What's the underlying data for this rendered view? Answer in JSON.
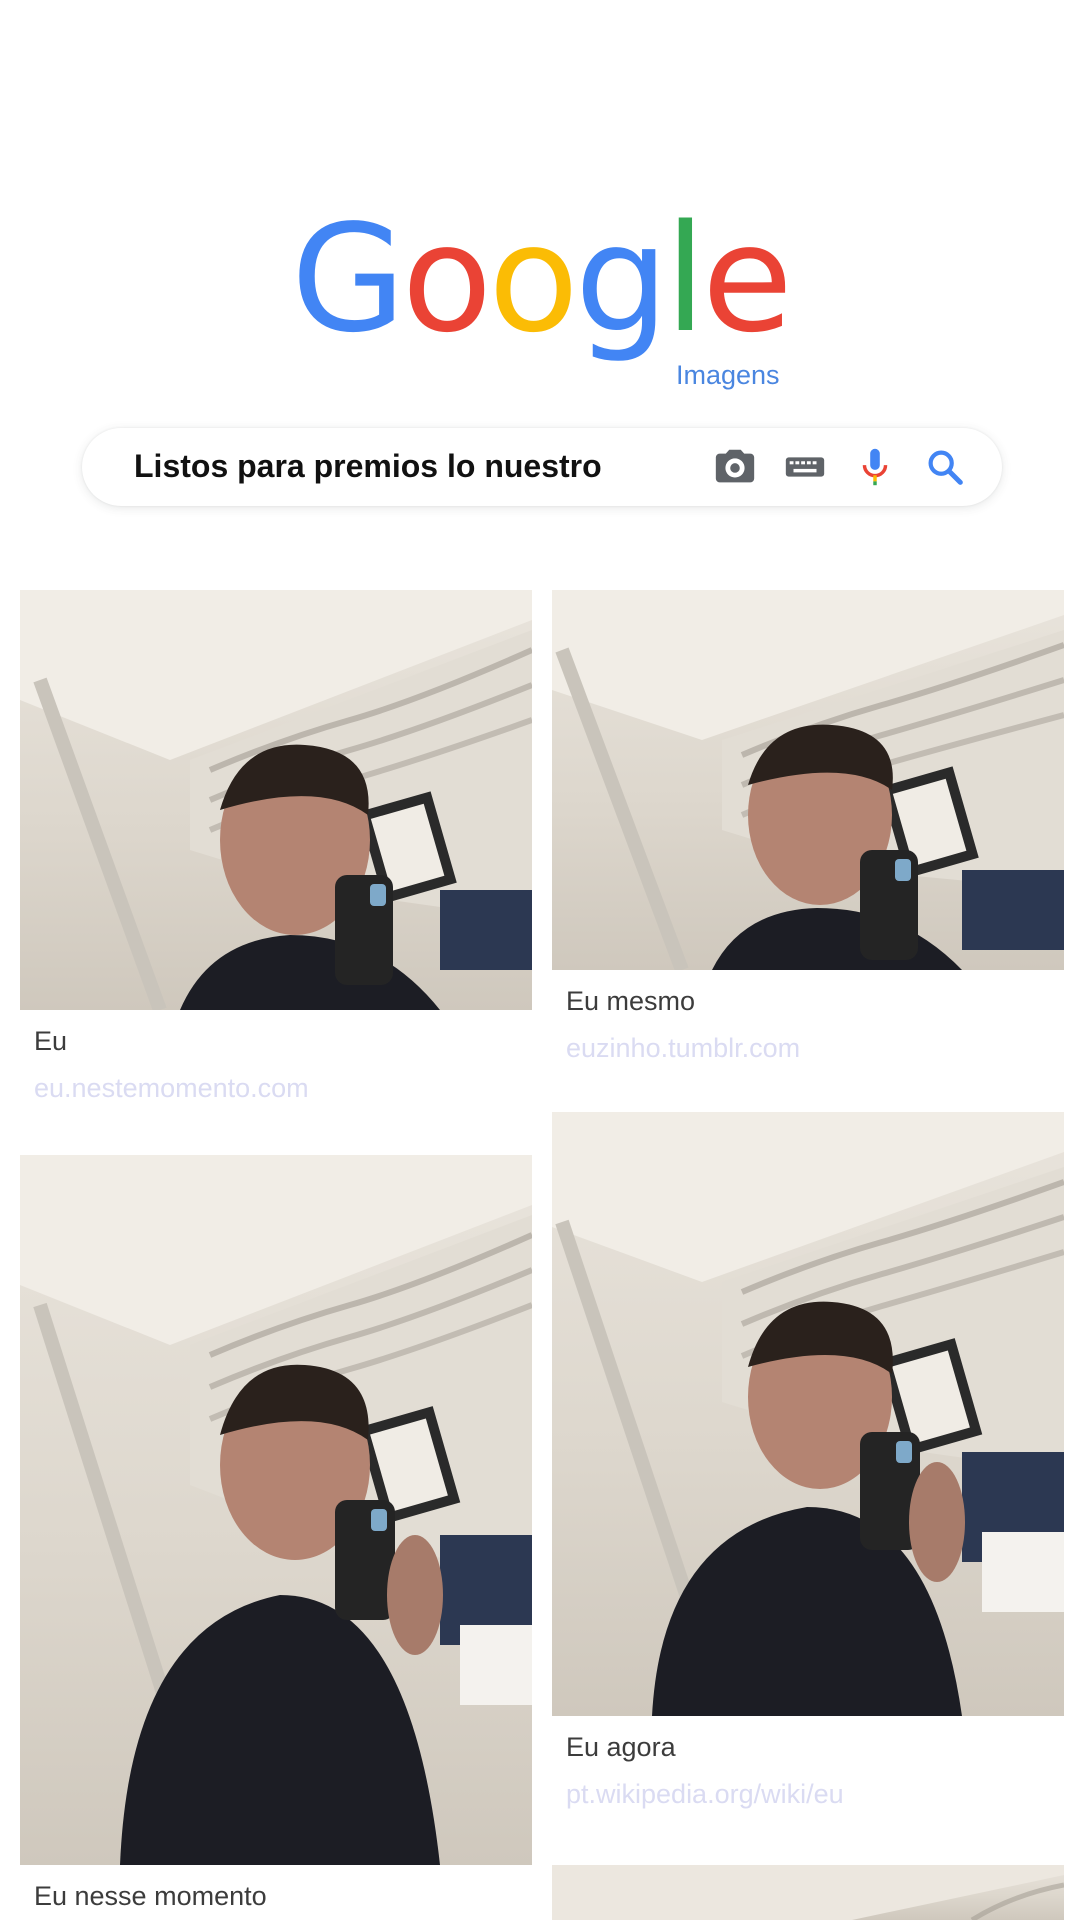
{
  "logo": {
    "letters": [
      {
        "char": "G",
        "color": "#4285F4"
      },
      {
        "char": "o",
        "color": "#EA4335"
      },
      {
        "char": "o",
        "color": "#FBBC05"
      },
      {
        "char": "g",
        "color": "#4285F4"
      },
      {
        "char": "l",
        "color": "#34A853"
      },
      {
        "char": "e",
        "color": "#EA4335"
      }
    ],
    "subtitle": "Imagens"
  },
  "search": {
    "query": "Listos para premios lo nuestro",
    "icons": [
      "camera-icon",
      "keyboard-icon",
      "microphone-icon",
      "search-icon"
    ]
  },
  "results": [
    {
      "title": "Eu",
      "source": "eu.nestemomento.com"
    },
    {
      "title": "Eu mesmo",
      "source": "euzinho.tumblr.com"
    },
    {
      "title": "Eu nesse momento",
      "source": ""
    },
    {
      "title": "Eu agora",
      "source": "pt.wikipedia.org/wiki/eu"
    }
  ],
  "colors": {
    "title_text": "#3c3c3c",
    "url_text": "#dadbf2",
    "logo_subtitle": "#4a86e0"
  }
}
